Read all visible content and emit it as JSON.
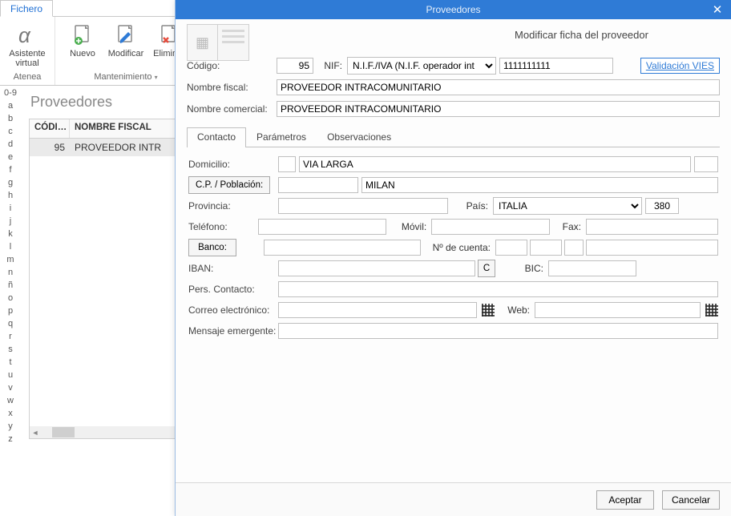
{
  "ribbon": {
    "tab_label": "Fichero",
    "group1_caption": "Atenea",
    "assistant_label": "Asistente\nvirtual",
    "group2_caption": "Mantenimiento",
    "nuevo_label": "Nuevo",
    "modificar_label": "Modificar",
    "eliminar_label": "Eliminar"
  },
  "az": [
    "0-9",
    "a",
    "b",
    "c",
    "d",
    "e",
    "f",
    "g",
    "h",
    "i",
    "j",
    "k",
    "l",
    "m",
    "n",
    "ñ",
    "o",
    "p",
    "q",
    "r",
    "s",
    "t",
    "u",
    "v",
    "w",
    "x",
    "y",
    "z"
  ],
  "list": {
    "title": "Proveedores",
    "col_codigo": "CÓDI…",
    "col_nombre": "NOMBRE FISCAL",
    "rows": [
      {
        "codigo": "95",
        "nombre": "PROVEEDOR INTR"
      }
    ]
  },
  "modal": {
    "title": "Proveedores",
    "subtitle": "Modificar ficha del proveedor",
    "labels": {
      "codigo": "Código:",
      "nif": "NIF:",
      "validacion": "Validación VIES",
      "nombre_fiscal": "Nombre fiscal:",
      "nombre_comercial": "Nombre comercial:",
      "domicilio": "Domicilio:",
      "cp": "C.P. / Población:",
      "provincia": "Provincia:",
      "pais": "País:",
      "telefono": "Teléfono:",
      "movil": "Móvil:",
      "fax": "Fax:",
      "banco": "Banco:",
      "ncuenta": "Nº de cuenta:",
      "iban": "IBAN:",
      "c": "C",
      "bic": "BIC:",
      "pers_contacto": "Pers. Contacto:",
      "correo": "Correo electrónico:",
      "web": "Web:",
      "mensaje": "Mensaje emergente:"
    },
    "tabs": {
      "contacto": "Contacto",
      "parametros": "Parámetros",
      "observaciones": "Observaciones"
    },
    "values": {
      "codigo": "95",
      "nif_tipo": "N.I.F./IVA (N.I.F. operador int",
      "nif": "1111111111",
      "nombre_fiscal": "PROVEEDOR INTRACOMUNITARIO",
      "nombre_comercial": "PROVEEDOR INTRACOMUNITARIO",
      "domicilio": "VIA LARGA",
      "poblacion": "MILAN",
      "pais": "ITALIA",
      "pais_code": "380"
    },
    "buttons": {
      "aceptar": "Aceptar",
      "cancelar": "Cancelar"
    }
  }
}
